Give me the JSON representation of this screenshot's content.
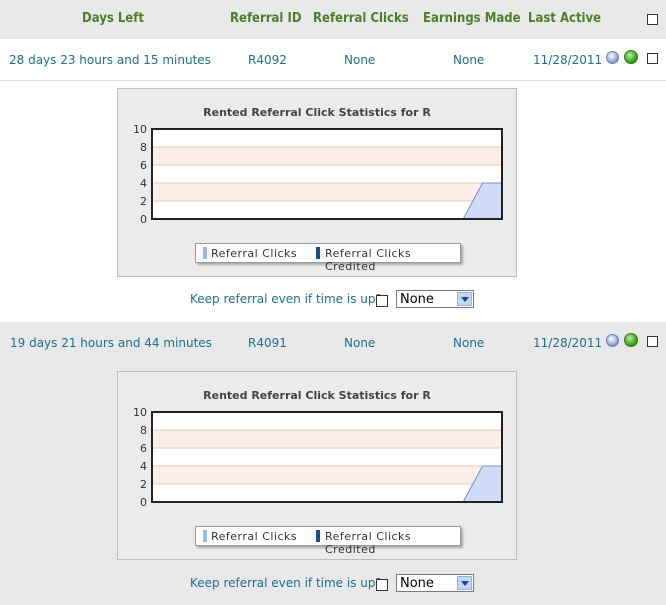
{
  "header": {
    "days_left": "Days Left",
    "referral_id": "Referral ID",
    "referral_clicks": "Referral Clicks",
    "earnings_made": "Earnings Made",
    "last_active": "Last Active"
  },
  "rows": [
    {
      "days_left": "28 days 23 hours and 15 minutes",
      "referral_id": "R4092",
      "referral_clicks": "None",
      "earnings_made": "None",
      "last_active": "11/28/2011",
      "chart_title": "Rented Referral Click Statistics for R",
      "keep_label": "Keep referral even if time is up?",
      "select_value": "None"
    },
    {
      "days_left": "19 days 21 hours and 44 minutes",
      "referral_id": "R4091",
      "referral_clicks": "None",
      "earnings_made": "None",
      "last_active": "11/28/2011",
      "chart_title": "Rented Referral Click Statistics for R",
      "keep_label": "Keep referral even if time is up?",
      "select_value": "None"
    }
  ],
  "legend": {
    "series1": "Referral Clicks",
    "series2": "Referral Clicks Credited"
  },
  "chart_data": [
    {
      "type": "area",
      "title": "Rented Referral Click Statistics for R",
      "ylim": [
        0,
        10
      ],
      "yticks": [
        "0",
        "2",
        "4",
        "6",
        "8",
        "10"
      ],
      "series": [
        {
          "name": "Referral Clicks",
          "values": [
            0,
            0,
            0,
            0,
            0,
            0,
            0,
            0,
            0,
            0,
            0,
            0,
            0,
            0,
            0,
            0,
            0,
            4,
            4
          ],
          "color": "#9ab8e8"
        },
        {
          "name": "Referral Clicks Credited",
          "values": [
            0,
            0,
            0,
            0,
            0,
            0,
            0,
            0,
            0,
            0,
            0,
            0,
            0,
            0,
            0,
            0,
            0,
            0,
            0
          ],
          "color": "#1a4f8a"
        }
      ],
      "grid": true,
      "legend_position": "bottom"
    },
    {
      "type": "area",
      "title": "Rented Referral Click Statistics for R",
      "ylim": [
        0,
        10
      ],
      "yticks": [
        "0",
        "2",
        "4",
        "6",
        "8",
        "10"
      ],
      "series": [
        {
          "name": "Referral Clicks",
          "values": [
            0,
            0,
            0,
            0,
            0,
            0,
            0,
            0,
            0,
            0,
            0,
            0,
            0,
            0,
            0,
            0,
            0,
            4,
            4
          ],
          "color": "#9ab8e8"
        },
        {
          "name": "Referral Clicks Credited",
          "values": [
            0,
            0,
            0,
            0,
            0,
            0,
            0,
            0,
            0,
            0,
            0,
            0,
            0,
            0,
            0,
            0,
            0,
            0,
            0
          ],
          "color": "#1a4f8a"
        }
      ],
      "grid": true,
      "legend_position": "bottom"
    }
  ]
}
